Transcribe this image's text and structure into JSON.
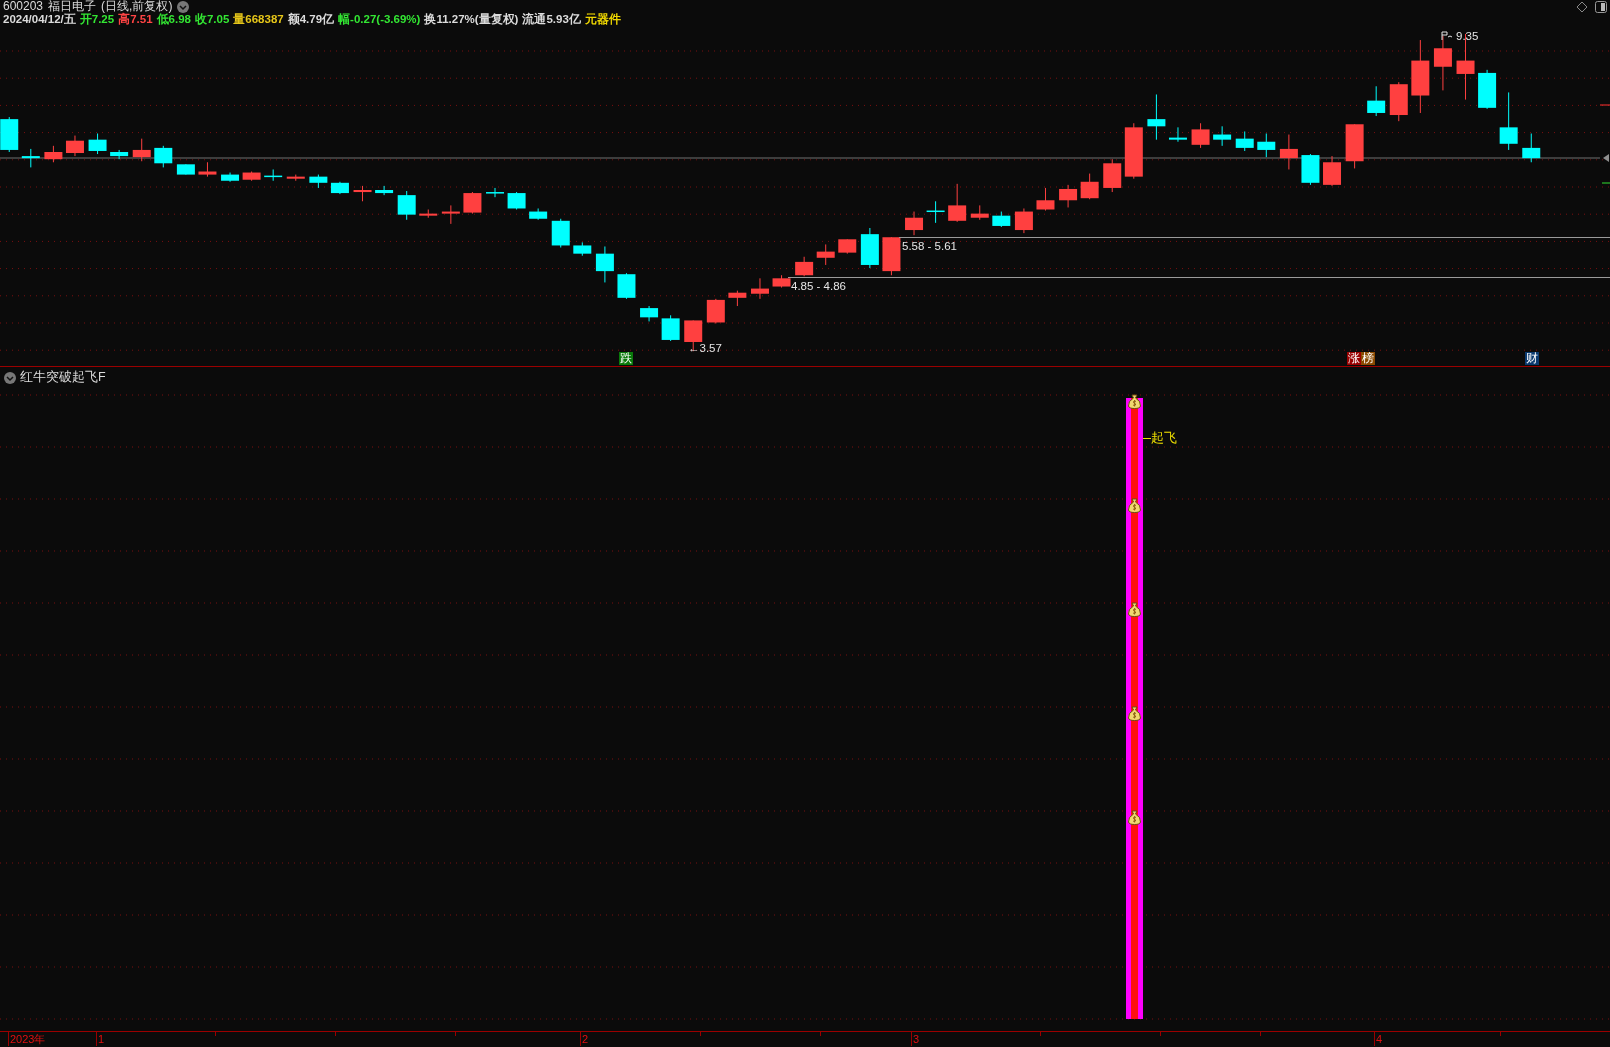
{
  "header": {
    "code": "600203",
    "name": "福日电子",
    "period": "(日线,前复权)"
  },
  "quote": [
    {
      "text": "2024/04/12/五",
      "color": "#dcdcdc"
    },
    {
      "text": "开7.25",
      "color": "#33e633"
    },
    {
      "text": "高7.51",
      "color": "#ff4444"
    },
    {
      "text": "低6.98",
      "color": "#33e633"
    },
    {
      "text": "收7.05",
      "color": "#33e633"
    },
    {
      "text": "量668387",
      "color": "#e6c619"
    },
    {
      "text": "额4.79亿",
      "color": "#dcdcdc"
    },
    {
      "text": "幅-0.27(-3.69%)",
      "color": "#33e633"
    },
    {
      "text": "换11.27%(量复权)",
      "color": "#dcdcdc"
    },
    {
      "text": "流通5.93亿",
      "color": "#dcdcdc"
    },
    {
      "text": "元器件",
      "color": "#f0d800"
    }
  ],
  "price_marks": [
    {
      "text": "9.35",
      "kind": "high"
    },
    {
      "text": "5.58 - 5.61",
      "kind": "range"
    },
    {
      "text": "4.85 - 4.86",
      "kind": "range"
    },
    {
      "text": "←3.57",
      "kind": "low"
    }
  ],
  "badges": [
    {
      "text": "跌",
      "color": "#0a7a0a"
    },
    {
      "text": "涨",
      "color": "#990000"
    },
    {
      "text": "榜",
      "color": "#8a4a00"
    },
    {
      "text": "财",
      "color": "#0a3a70"
    }
  ],
  "indicator": {
    "title": "红牛突破起飞F",
    "signal": "起飞"
  },
  "time_axis": [
    "2023年",
    "1",
    "2",
    "3",
    "4"
  ]
}
